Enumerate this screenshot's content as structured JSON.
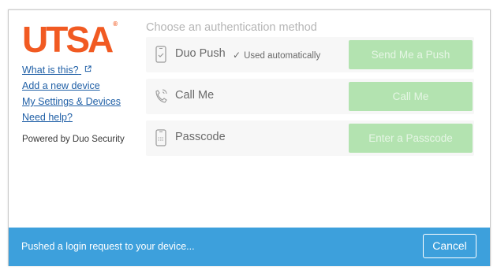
{
  "brand": {
    "logo_text": "UTSA",
    "logo_mark": "®",
    "logo_color": "#f15a22"
  },
  "sidebar": {
    "links": [
      {
        "label": "What is this?",
        "icon": "external-link-icon"
      },
      {
        "label": "Add a new device"
      },
      {
        "label": "My Settings & Devices"
      },
      {
        "label": "Need help?"
      }
    ],
    "powered_by": "Powered by Duo Security"
  },
  "main": {
    "heading": "Choose an authentication method",
    "methods": [
      {
        "icon": "phone-check-icon",
        "label": "Duo Push",
        "note": "Used automatically",
        "note_icon": "checkmark-icon",
        "button": "Send Me a Push"
      },
      {
        "icon": "phone-call-icon",
        "label": "Call Me",
        "button": "Call Me"
      },
      {
        "icon": "phone-passcode-icon",
        "label": "Passcode",
        "button": "Enter a Passcode"
      }
    ],
    "button_color": "#b3e3b0"
  },
  "status": {
    "message": "Pushed a login request to your device...",
    "cancel": "Cancel",
    "bar_color": "#3da0dc"
  }
}
